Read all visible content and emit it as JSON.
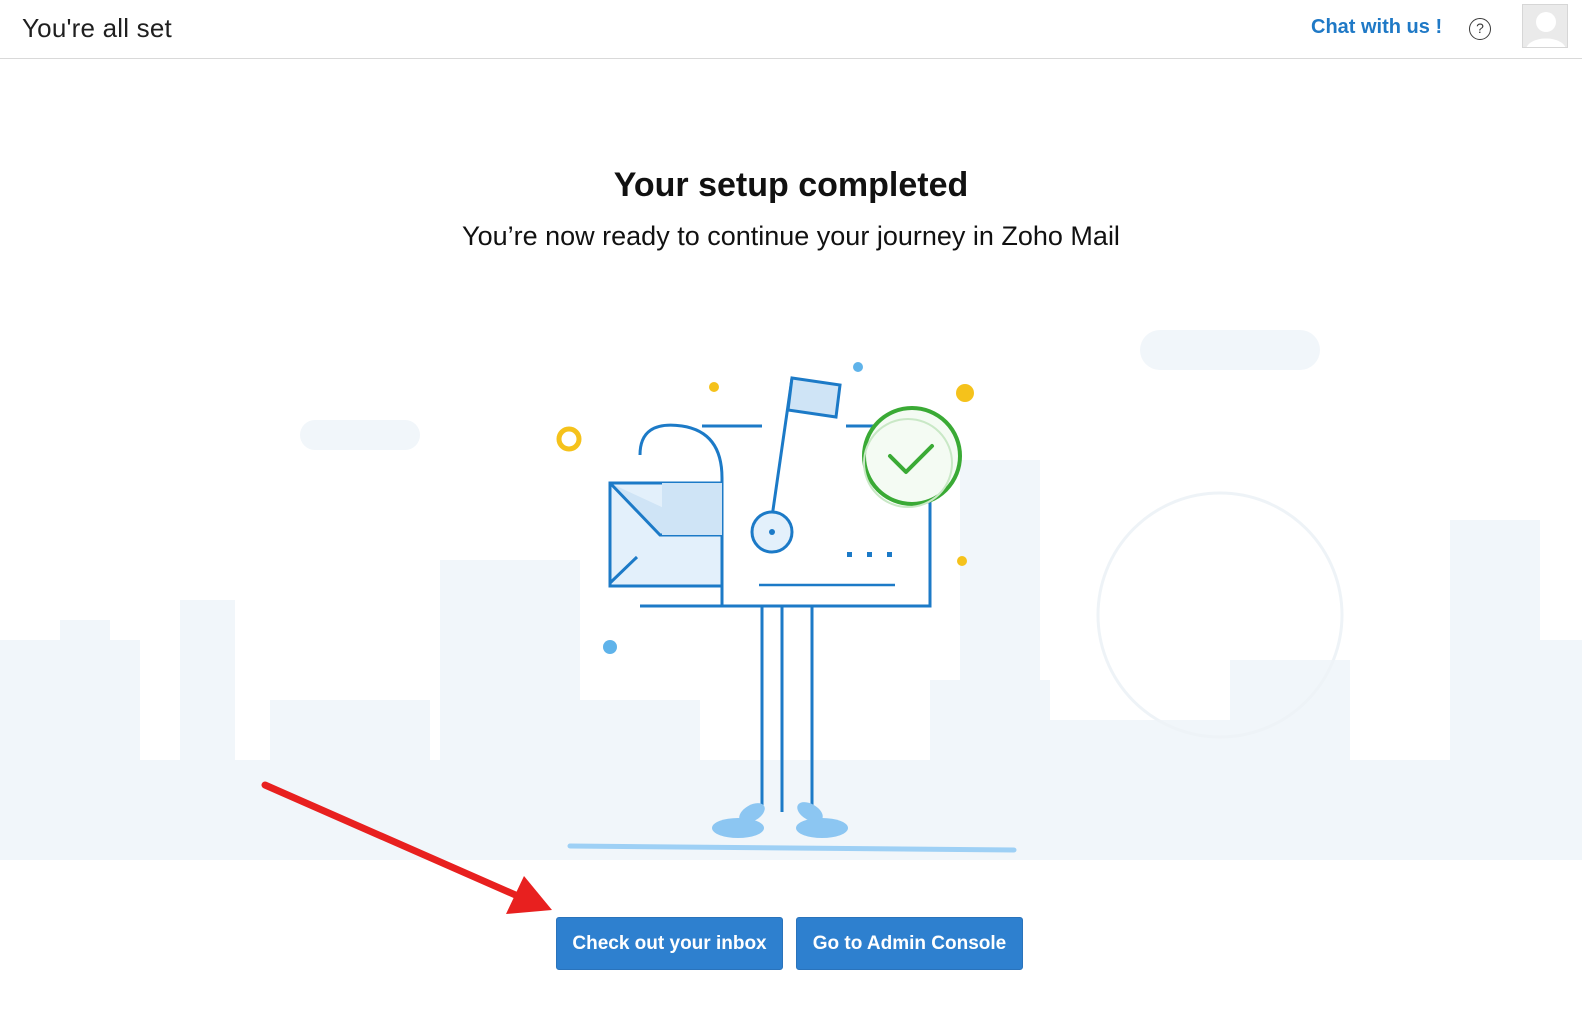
{
  "header": {
    "title": "You're all set",
    "chat_label": "Chat with us !",
    "help_icon_glyph": "?",
    "help_icon": "question-circle-icon",
    "avatar_icon": "user-avatar-icon"
  },
  "main": {
    "title": "Your setup completed",
    "subtitle": "You’re now ready to continue your journey in Zoho Mail",
    "illustration": "mailbox-with-checkmark-illustration"
  },
  "actions": {
    "inbox_label": "Check out your inbox",
    "admin_label": "Go to Admin Console"
  },
  "annotation": {
    "arrow": "red-arrow-annotation",
    "color": "#e8201f"
  },
  "colors": {
    "accent": "#2e80cf",
    "link": "#1f79c6",
    "success": "#3aaa35",
    "illustration_line": "#1c7ac7",
    "dot_yellow": "#f5c21b"
  }
}
